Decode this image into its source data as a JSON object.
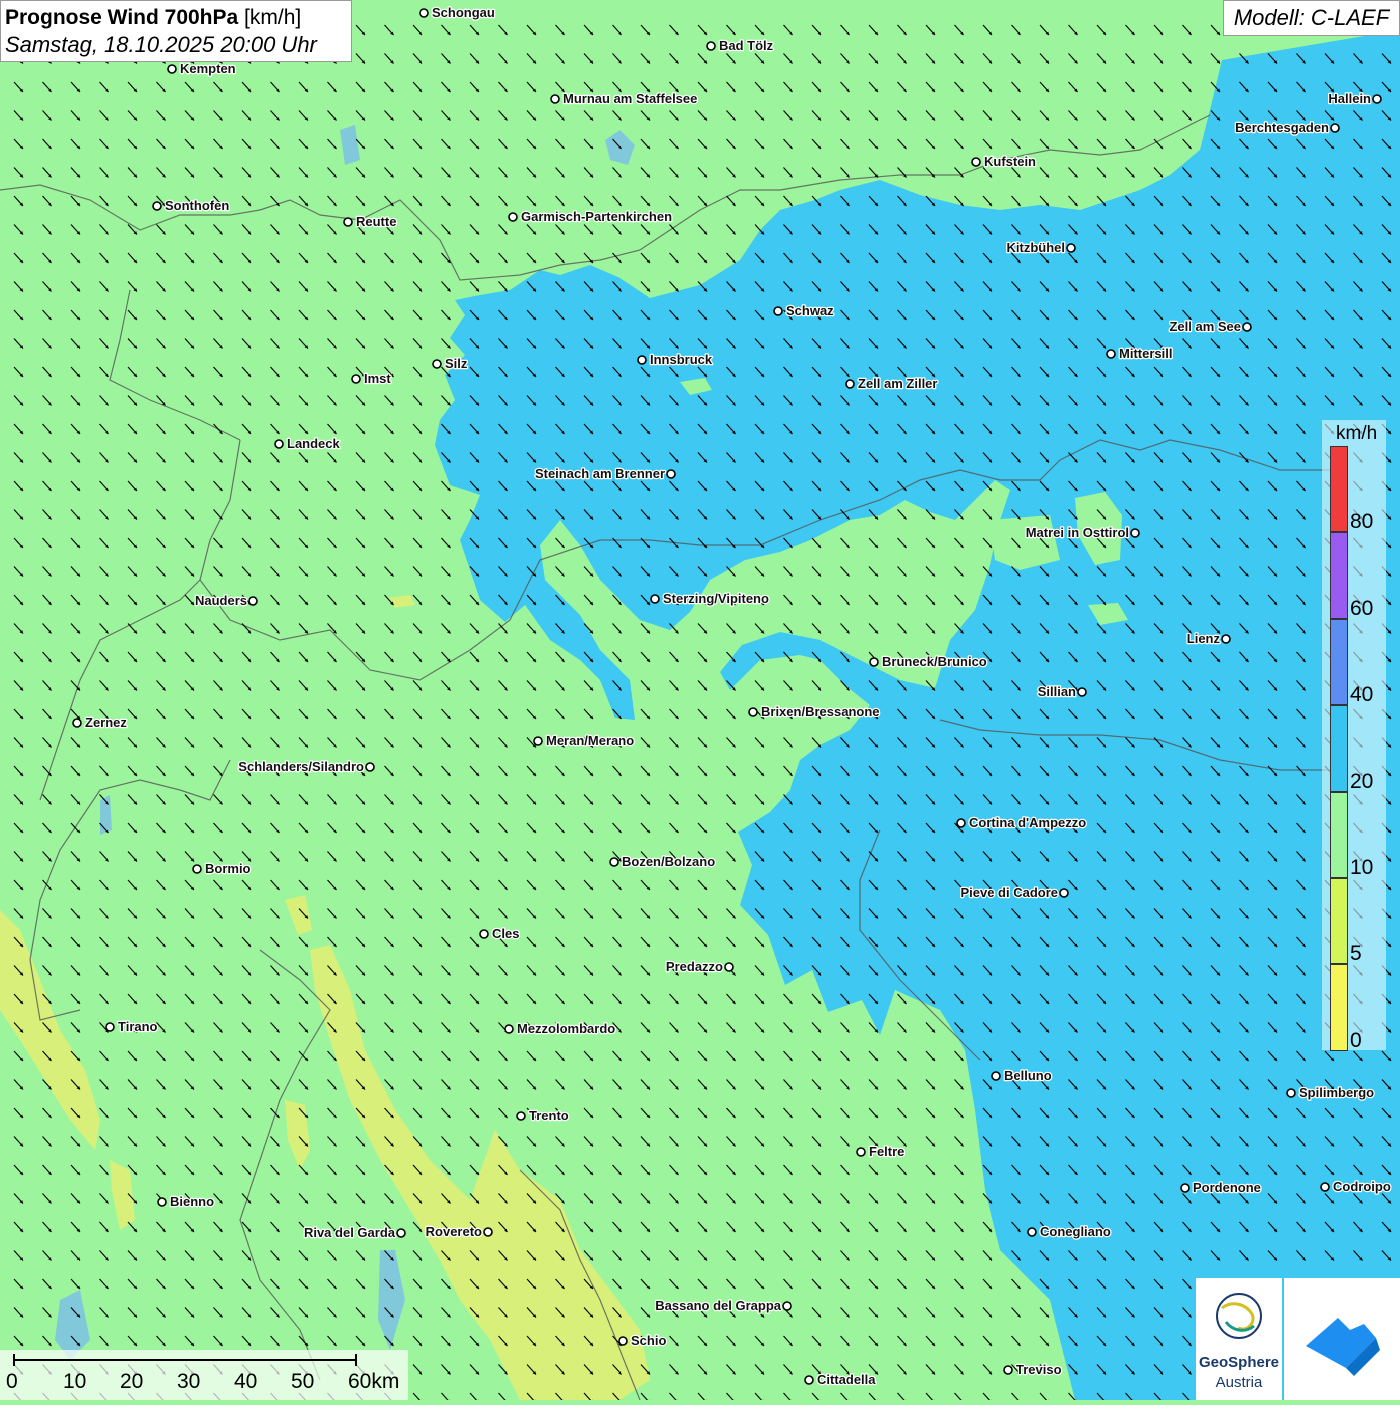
{
  "title": {
    "product": "Prognose Wind 700hPa",
    "unit": "[km/h]",
    "datetime": "Samstag, 18.10.2025 20:00 Uhr"
  },
  "model": "Modell: C-LAEF",
  "legend": {
    "unit": "km/h",
    "bands": [
      {
        "from": 80,
        "to": 100,
        "color": "#f03c3c"
      },
      {
        "from": 60,
        "to": 80,
        "color": "#9a5cf0"
      },
      {
        "from": 40,
        "to": 60,
        "color": "#5b8ef0"
      },
      {
        "from": 20,
        "to": 40,
        "color": "#37c4f0"
      },
      {
        "from": 10,
        "to": 20,
        "color": "#9cf59c"
      },
      {
        "from": 5,
        "to": 10,
        "color": "#d2f55a"
      },
      {
        "from": 0,
        "to": 5,
        "color": "#f5f55a"
      }
    ],
    "ticks": [
      "80",
      "60",
      "40",
      "20",
      "10",
      "5",
      "0"
    ]
  },
  "scale": {
    "labels": [
      "0",
      "10",
      "20",
      "30",
      "40",
      "50",
      "60km"
    ]
  },
  "cities": [
    {
      "name": "Schongau"
    },
    {
      "name": "Bad Tölz"
    },
    {
      "name": "Kempten"
    },
    {
      "name": "Murnau am Staffelsee"
    },
    {
      "name": "Hallein"
    },
    {
      "name": "Berchtesgaden"
    },
    {
      "name": "Kufstein"
    },
    {
      "name": "Sonthofen"
    },
    {
      "name": "Reutte"
    },
    {
      "name": "Garmisch-Partenkirchen"
    },
    {
      "name": "Kitzbühel"
    },
    {
      "name": "Schwaz"
    },
    {
      "name": "Zell am See"
    },
    {
      "name": "Innsbruck"
    },
    {
      "name": "Silz"
    },
    {
      "name": "Mittersill"
    },
    {
      "name": "Imst"
    },
    {
      "name": "Zell am Ziller"
    },
    {
      "name": "Landeck"
    },
    {
      "name": "Steinach am Brenner"
    },
    {
      "name": "Matrei in Osttirol"
    },
    {
      "name": "Nauders"
    },
    {
      "name": "Sterzing/Vipiteno"
    },
    {
      "name": "Lienz"
    },
    {
      "name": "Bruneck/Brunico"
    },
    {
      "name": "Sillian"
    },
    {
      "name": "Zernez"
    },
    {
      "name": "Brixen/Bressanone"
    },
    {
      "name": "Meran/Merano"
    },
    {
      "name": "Schlanders/Silandro"
    },
    {
      "name": "Cortina d'Ampezzo"
    },
    {
      "name": "Bozen/Bolzano"
    },
    {
      "name": "Bormio"
    },
    {
      "name": "Pieve di Cadore"
    },
    {
      "name": "Cles"
    },
    {
      "name": "Predazzo"
    },
    {
      "name": "Tirano"
    },
    {
      "name": "Mezzolombardo"
    },
    {
      "name": "Belluno"
    },
    {
      "name": "Spilimbergo"
    },
    {
      "name": "Trento"
    },
    {
      "name": "Feltre"
    },
    {
      "name": "Bienno"
    },
    {
      "name": "Pordenone"
    },
    {
      "name": "Codroipo"
    },
    {
      "name": "Riva del Garda"
    },
    {
      "name": "Rovereto"
    },
    {
      "name": "Conegliano"
    },
    {
      "name": "Bassano del Grappa"
    },
    {
      "name": "Schio"
    },
    {
      "name": "Treviso"
    },
    {
      "name": "Cittadella"
    }
  ],
  "logo": {
    "line1": "GeoSphere",
    "line2": "Austria"
  }
}
